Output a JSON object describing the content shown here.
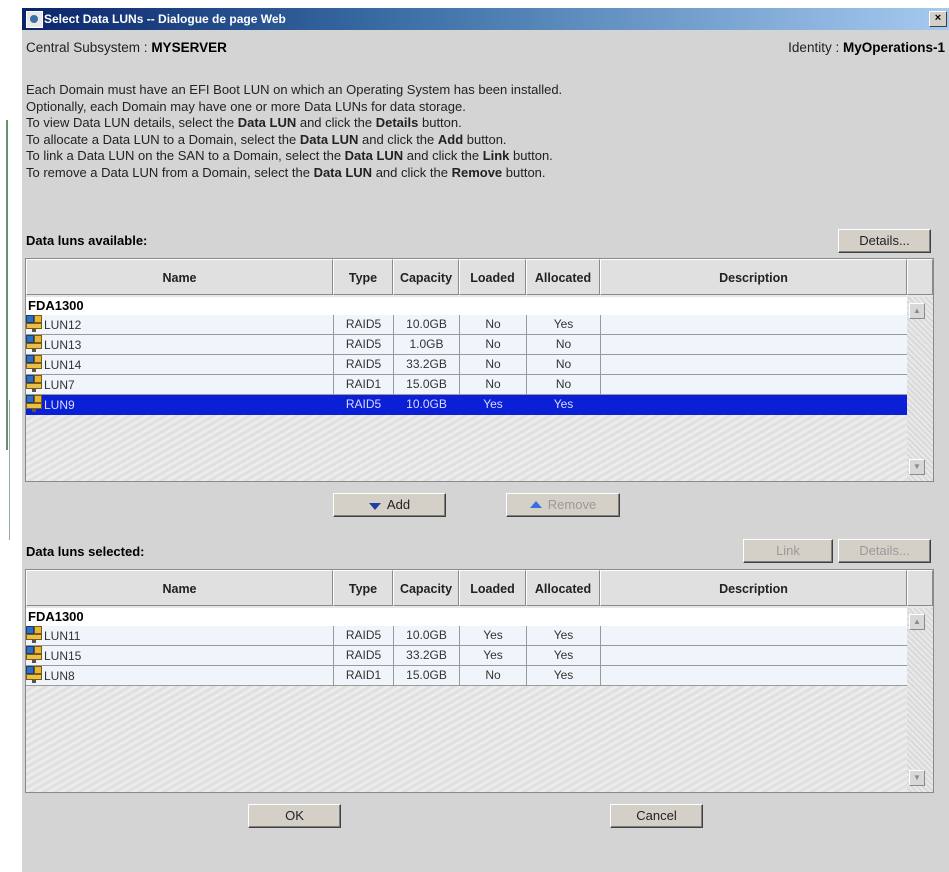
{
  "window": {
    "title": "Select Data LUNs -- Dialogue de page Web",
    "close_label": "×"
  },
  "header": {
    "subsystem_label": "Central Subsystem :",
    "subsystem_value": "MYSERVER",
    "identity_label": "Identity :",
    "identity_value": "MyOperations-1"
  },
  "instructions": [
    {
      "pre": "Each Domain must have an EFI Boot LUN on which an Operating System has been installed.",
      "b1": "",
      "mid": "",
      "b2": "",
      "post": ""
    },
    {
      "pre": "Optionally, each Domain may have one or more Data LUNs for data storage.",
      "b1": "",
      "mid": "",
      "b2": "",
      "post": ""
    },
    {
      "pre": "To view Data LUN details, select the ",
      "b1": "Data LUN",
      "mid": " and click the ",
      "b2": "Details",
      "post": " button."
    },
    {
      "pre": "To allocate a Data LUN to a Domain, select the ",
      "b1": "Data LUN",
      "mid": " and click the ",
      "b2": "Add",
      "post": " button."
    },
    {
      "pre": "To link a Data LUN on the SAN to a Domain, select the ",
      "b1": "Data LUN",
      "mid": " and click the ",
      "b2": "Link",
      "post": " button."
    },
    {
      "pre": "To remove a Data LUN from a Domain, select the ",
      "b1": "Data LUN",
      "mid": " and click the ",
      "b2": "Remove",
      "post": " button."
    }
  ],
  "columns": [
    "Name",
    "Type",
    "Capacity",
    "Loaded",
    "Allocated",
    "Description"
  ],
  "available": {
    "title": "Data luns available:",
    "details_label": "Details...",
    "group": "FDA1300",
    "rows": [
      {
        "name": "LUN12",
        "type": "RAID5",
        "capacity": "10.0GB",
        "loaded": "No",
        "allocated": "Yes",
        "description": ""
      },
      {
        "name": "LUN13",
        "type": "RAID5",
        "capacity": "1.0GB",
        "loaded": "No",
        "allocated": "No",
        "description": ""
      },
      {
        "name": "LUN14",
        "type": "RAID5",
        "capacity": "33.2GB",
        "loaded": "No",
        "allocated": "No",
        "description": ""
      },
      {
        "name": "LUN7",
        "type": "RAID1",
        "capacity": "15.0GB",
        "loaded": "No",
        "allocated": "No",
        "description": ""
      },
      {
        "name": "LUN9",
        "type": "RAID5",
        "capacity": "10.0GB",
        "loaded": "Yes",
        "allocated": "Yes",
        "description": "",
        "selected": true
      }
    ]
  },
  "actions": {
    "add_label": "Add",
    "remove_label": "Remove"
  },
  "selected": {
    "title": "Data luns selected:",
    "link_label": "Link",
    "details_label": "Details...",
    "group": "FDA1300",
    "rows": [
      {
        "name": "LUN11",
        "type": "RAID5",
        "capacity": "10.0GB",
        "loaded": "Yes",
        "allocated": "Yes",
        "description": ""
      },
      {
        "name": "LUN15",
        "type": "RAID5",
        "capacity": "33.2GB",
        "loaded": "Yes",
        "allocated": "Yes",
        "description": ""
      },
      {
        "name": "LUN8",
        "type": "RAID1",
        "capacity": "15.0GB",
        "loaded": "No",
        "allocated": "Yes",
        "description": ""
      }
    ]
  },
  "footer": {
    "ok_label": "OK",
    "cancel_label": "Cancel"
  },
  "icons": {
    "lun": "lun-storage-icon",
    "add": "arrow-down-icon",
    "remove": "arrow-up-icon"
  },
  "colors": {
    "selection": "#0a1fd6",
    "title_bar": "#0a246a"
  }
}
